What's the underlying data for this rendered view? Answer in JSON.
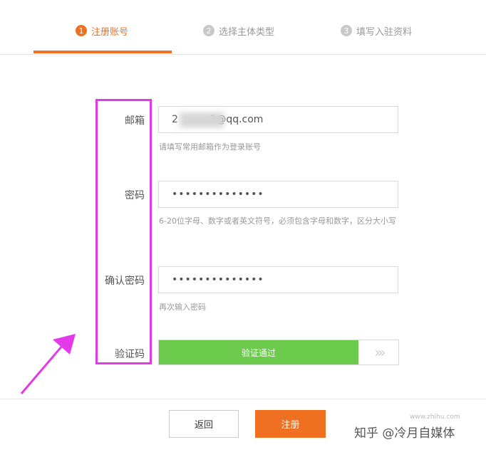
{
  "steps": [
    {
      "num": "1",
      "label": "注册账号",
      "active": true
    },
    {
      "num": "2",
      "label": "选择主体类型",
      "active": false
    },
    {
      "num": "3",
      "label": "填写入驻资料",
      "active": false
    }
  ],
  "form": {
    "email": {
      "label": "邮箱",
      "value": "2          2@qq.com",
      "hint": "请填写常用邮箱作为登录账号"
    },
    "password": {
      "label": "密码",
      "value": "••••••••••••••",
      "hint": "6-20位字母、数字或者英文符号，必须包含字母和数字，区分大小写"
    },
    "confirm": {
      "label": "确认密码",
      "value": "••••••••••••••",
      "hint": "再次输入密码"
    },
    "captcha": {
      "label": "验证码",
      "status": "验证通过",
      "handle_icon": "double-chevron-right-icon"
    }
  },
  "buttons": {
    "back": "返回",
    "submit": "注册"
  },
  "watermark": {
    "text": "知乎 @冷月自媒体",
    "small": "www.zhihu.com"
  },
  "colors": {
    "accent": "#f07021",
    "success": "#6ccb4c",
    "highlight": "#e23ae8"
  }
}
